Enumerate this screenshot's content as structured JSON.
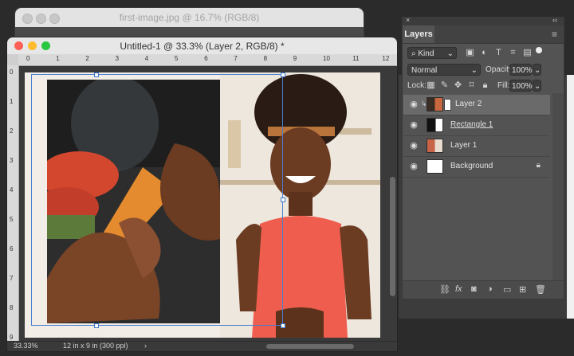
{
  "back_window": {
    "title": "first-image.jpg @ 16.7% (RGB/8)"
  },
  "main_window": {
    "title": "Untitled-1 @ 33.3% (Layer 2, RGB/8) *",
    "ruler_h": [
      "0",
      "1",
      "2",
      "3",
      "4",
      "5",
      "6",
      "7",
      "8",
      "9",
      "10",
      "11",
      "12"
    ],
    "ruler_v": [
      "0",
      "1",
      "2",
      "3",
      "4",
      "5",
      "6",
      "7",
      "8",
      "9"
    ],
    "status": {
      "zoom": "33.33%",
      "doc_info": "12 in x 9 in (300 ppi)",
      "arrow": "›"
    }
  },
  "layers_panel": {
    "collapse_glyph": "‹‹",
    "close_glyph": "×",
    "tab_label": "Layers",
    "menu_glyph": "≡",
    "filter_kind": "Kind",
    "blend_mode": "Normal",
    "opacity_label": "Opacity:",
    "opacity_value": "100%",
    "lock_label": "Lock:",
    "fill_label": "Fill:",
    "fill_value": "100%",
    "layers": [
      {
        "name": "Layer 2",
        "selected": true
      },
      {
        "name": "Rectangle 1",
        "selected": false
      },
      {
        "name": "Layer 1",
        "selected": false
      },
      {
        "name": "Background",
        "selected": false,
        "locked": true
      }
    ],
    "filter_icons": [
      "image-filter-icon",
      "adjustment-filter-icon",
      "type-filter-icon",
      "shape-filter-icon",
      "smart-object-filter-icon"
    ],
    "bottom_icons": [
      "link-icon",
      "fx-icon",
      "mask-icon",
      "adjustment-icon",
      "folder-icon",
      "new-layer-icon",
      "trash-icon"
    ]
  },
  "colors": {
    "selection_blue": "#4a7fd0",
    "panel_bg": "#535353",
    "selected_row": "#6a6a6a"
  }
}
